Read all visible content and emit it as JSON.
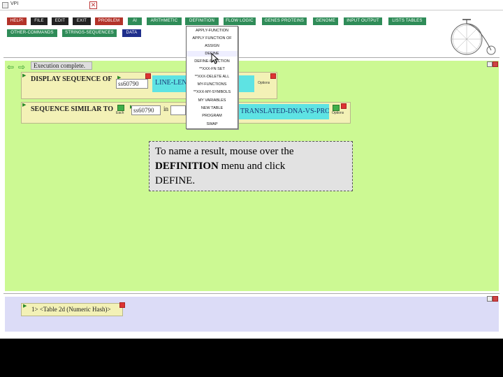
{
  "window": {
    "title": "VPI",
    "close_glyph": "✕"
  },
  "menubar": {
    "row1": [
      {
        "label": "HELP!",
        "color": "red"
      },
      {
        "label": "FILE",
        "color": "black"
      },
      {
        "label": "EDIT",
        "color": "black"
      },
      {
        "label": "EXIT",
        "color": "black"
      },
      {
        "label": "PROBLEM",
        "color": "red"
      },
      {
        "label": "AI",
        "color": "green"
      },
      {
        "label": "ARITHMETIC",
        "color": "green"
      },
      {
        "label": "DEFINITION",
        "color": "green"
      },
      {
        "label": "FLOW LOGIC",
        "color": "green"
      },
      {
        "label": "GENES PROTEINS",
        "color": "green"
      },
      {
        "label": "GENOME",
        "color": "green"
      },
      {
        "label": "INPUT OUTPUT",
        "color": "green"
      },
      {
        "label": "LISTS TABLES",
        "color": "green"
      }
    ],
    "row2": [
      {
        "label": "OTHER-COMMANDS",
        "color": "green"
      },
      {
        "label": "STRINGS-SEQUENCES",
        "color": "green"
      },
      {
        "label": "DATA",
        "color": "blue"
      }
    ]
  },
  "nav": {
    "back_glyph": "⇦",
    "forward_glyph": "⇨"
  },
  "status": "Execution complete.",
  "functions": [
    {
      "title": "DISPLAY SEQUENCE OF",
      "arg": "ss60790",
      "value": "LINE-LENGTH ... FASTA",
      "options": "Options"
    },
    {
      "title": "SEQUENCE SIMILAR TO",
      "arg": "ss60790",
      "in_label": "in",
      "value": "TRANSLATED-DNA-VS-PROTEIN",
      "options": "Options",
      "small_label": "Each"
    }
  ],
  "dropdown": {
    "items": [
      "APPLY-FUNCTION",
      "APPLY FUNCTION OF",
      "ASSIGN",
      "DEFINE",
      "DEFINE-FUNCTION",
      "**XXX-FN SET",
      "**XXX-DELETE ALL",
      "MY-FUNCTIONS",
      "**XXX-MY-SYMBOLS",
      "MY VARIABLES",
      "NEW TABLE",
      "PROGRAM",
      "SWAP"
    ]
  },
  "tooltip": {
    "line1": "To name a result, mouse over the",
    "bold": "DEFINITION",
    "rest": " menu and click",
    "line3": "DEFINE."
  },
  "result": {
    "index": "1>",
    "text": "<Table 2d (Numeric Hash)>"
  },
  "colors": {
    "workspace": "#ccf993",
    "bottom_pane": "#dcdcf7",
    "menu_red": "#b3332a",
    "menu_green": "#2f8c58",
    "menu_blue": "#1f2f8c",
    "function_box": "#f3f1b6",
    "value_box": "#5ee3e3"
  }
}
